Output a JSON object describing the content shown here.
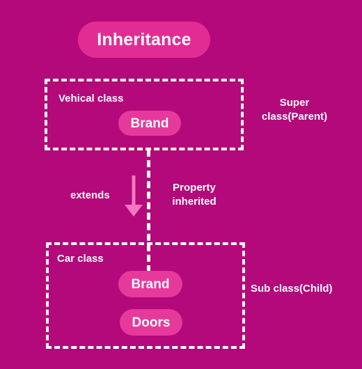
{
  "diagram": {
    "title": "Inheritance",
    "background_color": "#b3097a",
    "accent_pill_color": "#e6399b",
    "arrow_color": "#f279bf",
    "line_color": "#ffffff",
    "super_class": {
      "name": "Vehical class",
      "role_label_line1": "Super",
      "role_label_line2": "class(Parent)",
      "members": [
        {
          "name": "Brand"
        }
      ]
    },
    "sub_class": {
      "name": "Car class",
      "role_label": "Sub class(Child)",
      "members": [
        {
          "name": "Brand"
        },
        {
          "name": "Doors"
        }
      ]
    },
    "relationship": {
      "keyword_label": "extends",
      "effect_label_line1": "Property",
      "effect_label_line2": "inherited",
      "arrow_icon": "down-arrow-icon",
      "connector_icon": "vertical-dashed-line-icon"
    }
  }
}
